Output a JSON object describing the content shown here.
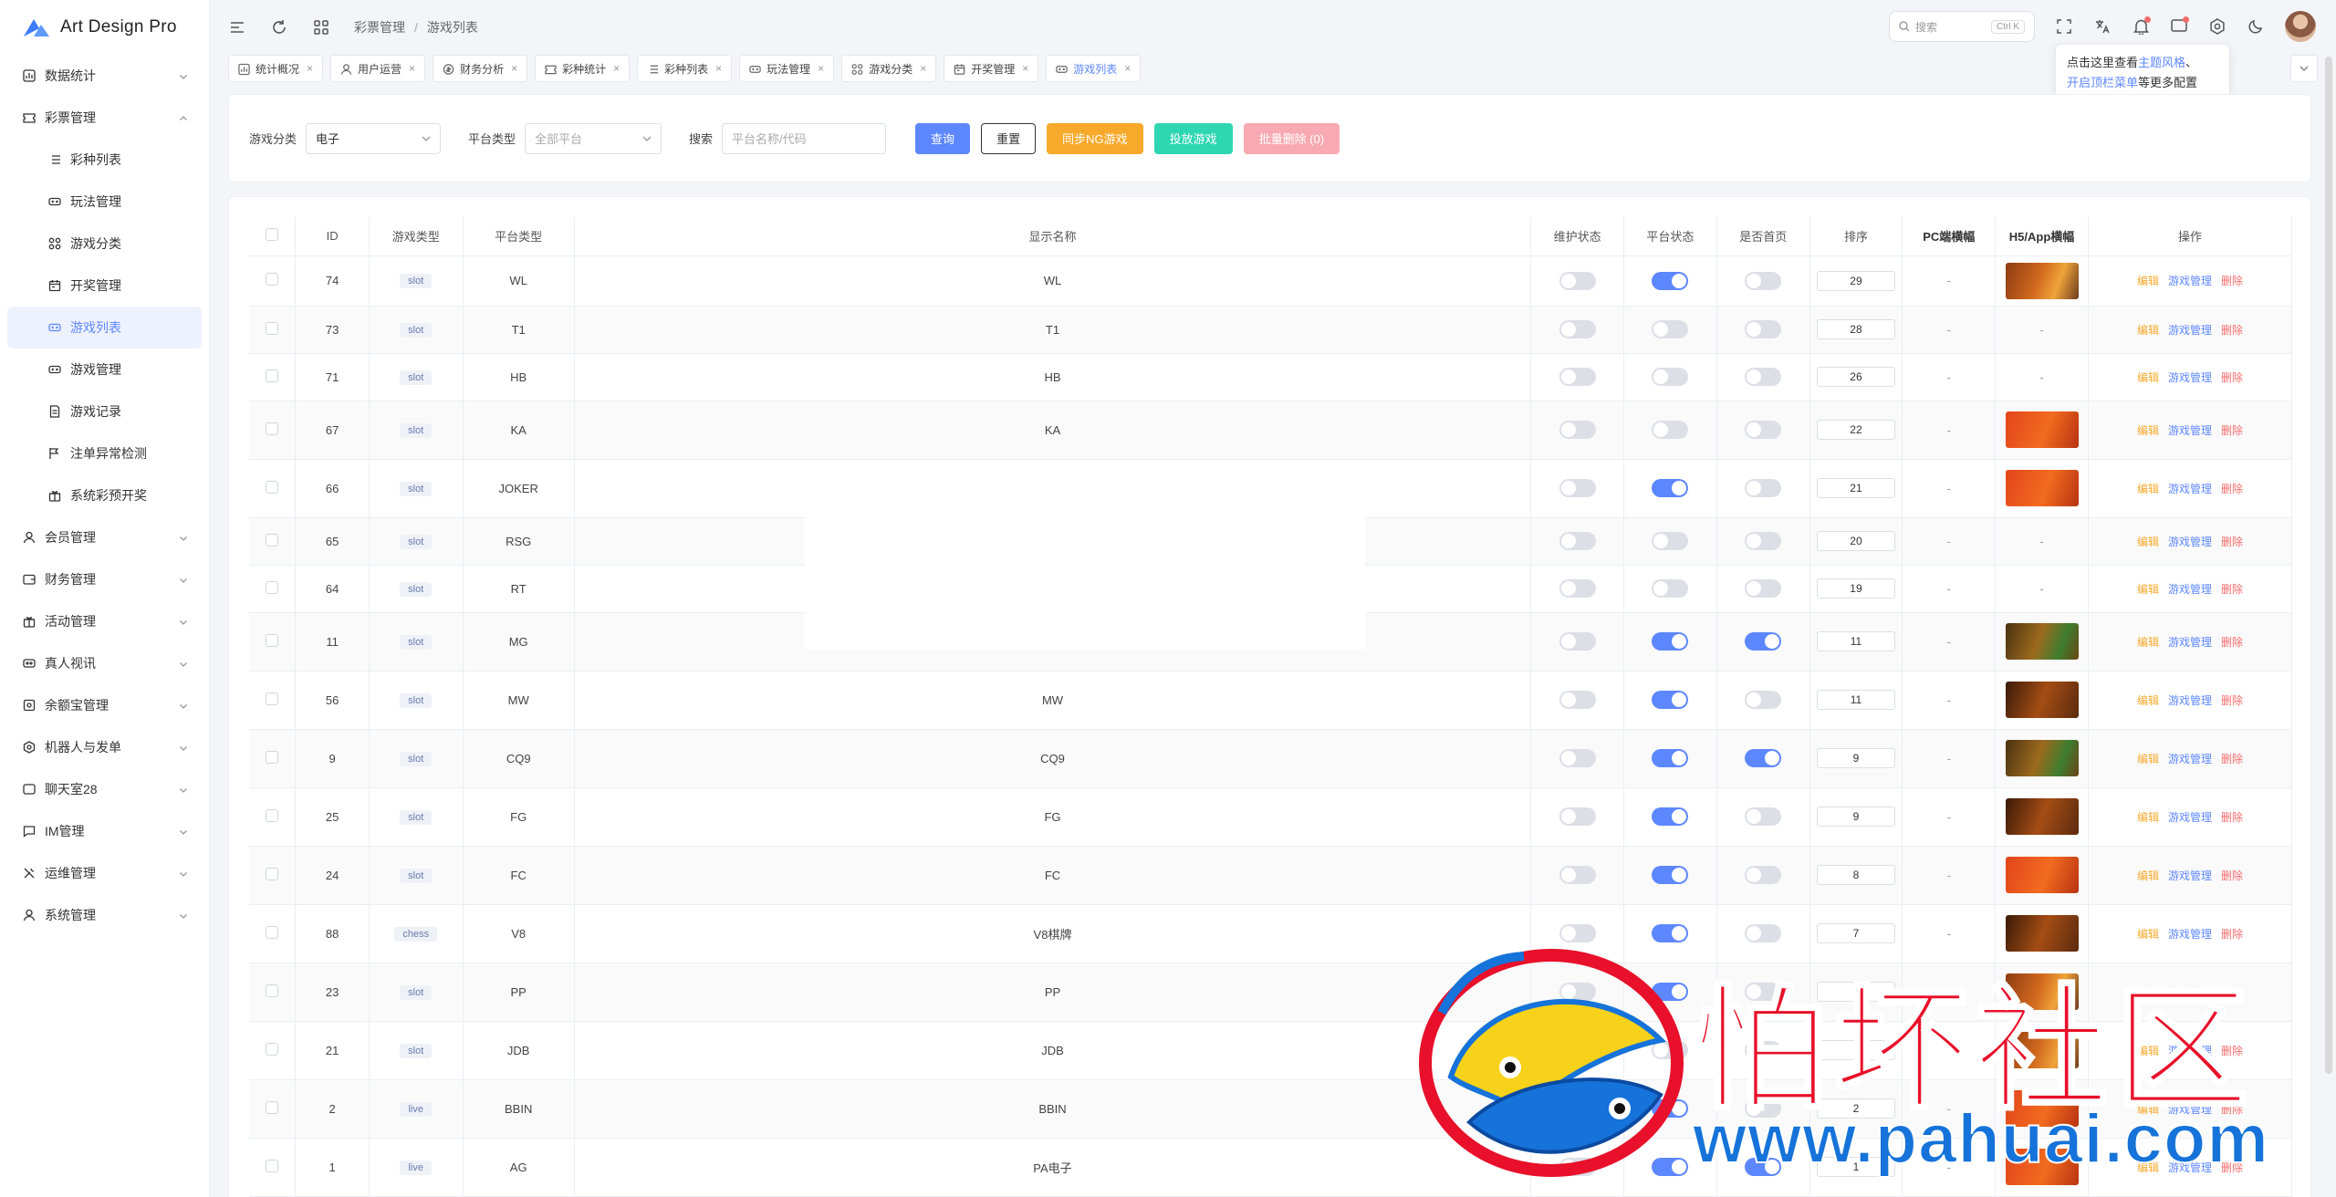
{
  "app": {
    "name": "Art Design Pro"
  },
  "sidebar": {
    "groups": [
      {
        "label": "数据统计",
        "icon": "chart-grid-icon",
        "expanded": false
      },
      {
        "label": "彩票管理",
        "icon": "ticket-icon",
        "expanded": true
      },
      {
        "label": "会员管理",
        "icon": "user-icon",
        "expanded": false
      },
      {
        "label": "财务管理",
        "icon": "wallet-icon",
        "expanded": false
      },
      {
        "label": "活动管理",
        "icon": "gift-icon",
        "expanded": false
      },
      {
        "label": "真人视讯",
        "icon": "video-icon",
        "expanded": false
      },
      {
        "label": "余额宝管理",
        "icon": "safe-icon",
        "expanded": false
      },
      {
        "label": "机器人与发单",
        "icon": "robot-icon",
        "expanded": false
      },
      {
        "label": "聊天室28",
        "icon": "chat-room-icon",
        "expanded": false
      },
      {
        "label": "IM管理",
        "icon": "message-icon",
        "expanded": false
      },
      {
        "label": "运维管理",
        "icon": "tools-icon",
        "expanded": false
      },
      {
        "label": "系统管理",
        "icon": "user-gear-icon",
        "expanded": false
      }
    ],
    "sub_items": [
      {
        "label": "彩种列表",
        "icon": "list-icon",
        "active": false
      },
      {
        "label": "玩法管理",
        "icon": "gamepad-icon",
        "active": false
      },
      {
        "label": "游戏分类",
        "icon": "category-icon",
        "active": false
      },
      {
        "label": "开奖管理",
        "icon": "calendar-icon",
        "active": false
      },
      {
        "label": "游戏列表",
        "icon": "gamepad-icon",
        "active": true
      },
      {
        "label": "游戏管理",
        "icon": "gamepad-icon",
        "active": false
      },
      {
        "label": "游戏记录",
        "icon": "record-icon",
        "active": false
      },
      {
        "label": "注单异常检测",
        "icon": "inspect-icon",
        "active": false
      },
      {
        "label": "系统彩预开奖",
        "icon": "gift-icon",
        "active": false
      }
    ]
  },
  "topbar": {
    "breadcrumb": [
      "彩票管理",
      "游戏列表"
    ],
    "search_placeholder": "搜索",
    "search_shortcut": "Ctrl K"
  },
  "tooltip": {
    "line1_pre": "点击这里查看",
    "line1_hl": "主题风格",
    "line1_post": "、",
    "line2_pre": "开启",
    "line2_hl": "顶栏菜单",
    "line2_post": "等更多配置"
  },
  "tabs": [
    {
      "label": "统计概况",
      "icon": "chart-grid-icon",
      "active": false
    },
    {
      "label": "用户运营",
      "icon": "user-icon",
      "active": false
    },
    {
      "label": "财务分析",
      "icon": "coin-icon",
      "active": false
    },
    {
      "label": "彩种统计",
      "icon": "ticket-icon",
      "active": false
    },
    {
      "label": "彩种列表",
      "icon": "list-icon",
      "active": false
    },
    {
      "label": "玩法管理",
      "icon": "gamepad-icon",
      "active": false
    },
    {
      "label": "游戏分类",
      "icon": "category-icon",
      "active": false
    },
    {
      "label": "开奖管理",
      "icon": "calendar-icon",
      "active": false
    },
    {
      "label": "游戏列表",
      "icon": "gamepad-icon",
      "active": true
    }
  ],
  "filter": {
    "category_label": "游戏分类",
    "category_value": "电子",
    "platform_label": "平台类型",
    "platform_placeholder": "全部平台",
    "search_label": "搜索",
    "search_placeholder": "平台名称/代码",
    "btn_query": "查询",
    "btn_reset": "重置",
    "btn_sync": "同步NG游戏",
    "btn_add": "投放游戏",
    "btn_batch_delete": "批量删除 (0)"
  },
  "table": {
    "headers": [
      "ID",
      "游戏类型",
      "平台类型",
      "显示名称",
      "维护状态",
      "平台状态",
      "是否首页",
      "排序",
      "PC端横幅",
      "H5/App横幅",
      "操作"
    ],
    "actions": {
      "edit": "编辑",
      "manage": "游戏管理",
      "delete": "删除"
    },
    "dash": "-",
    "rows": [
      {
        "id": "74",
        "type": "slot",
        "platform": "WL",
        "name": "WL",
        "maint": false,
        "plat_on": true,
        "home": false,
        "sort": "29",
        "h5_banner": "orange"
      },
      {
        "id": "73",
        "type": "slot",
        "platform": "T1",
        "name": "T1",
        "maint": false,
        "plat_on": false,
        "home": false,
        "sort": "28",
        "h5_banner": ""
      },
      {
        "id": "71",
        "type": "slot",
        "platform": "HB",
        "name": "HB",
        "maint": false,
        "plat_on": false,
        "home": false,
        "sort": "26",
        "h5_banner": ""
      },
      {
        "id": "67",
        "type": "slot",
        "platform": "KA",
        "name": "KA",
        "maint": false,
        "plat_on": false,
        "home": false,
        "sort": "22",
        "h5_banner": "red"
      },
      {
        "id": "66",
        "type": "slot",
        "platform": "JOKER",
        "name": "",
        "maint": false,
        "plat_on": true,
        "home": false,
        "sort": "21",
        "h5_banner": "red"
      },
      {
        "id": "65",
        "type": "slot",
        "platform": "RSG",
        "name": "",
        "maint": false,
        "plat_on": false,
        "home": false,
        "sort": "20",
        "h5_banner": ""
      },
      {
        "id": "64",
        "type": "slot",
        "platform": "RT",
        "name": "",
        "maint": false,
        "plat_on": false,
        "home": false,
        "sort": "19",
        "h5_banner": ""
      },
      {
        "id": "11",
        "type": "slot",
        "platform": "MG",
        "name": "MG",
        "maint": false,
        "plat_on": true,
        "home": true,
        "sort": "11",
        "h5_banner": "green"
      },
      {
        "id": "56",
        "type": "slot",
        "platform": "MW",
        "name": "MW",
        "maint": false,
        "plat_on": true,
        "home": false,
        "sort": "11",
        "h5_banner": "dark"
      },
      {
        "id": "9",
        "type": "slot",
        "platform": "CQ9",
        "name": "CQ9",
        "maint": false,
        "plat_on": true,
        "home": true,
        "sort": "9",
        "h5_banner": "green"
      },
      {
        "id": "25",
        "type": "slot",
        "platform": "FG",
        "name": "FG",
        "maint": false,
        "plat_on": true,
        "home": false,
        "sort": "9",
        "h5_banner": "dark"
      },
      {
        "id": "24",
        "type": "slot",
        "platform": "FC",
        "name": "FC",
        "maint": false,
        "plat_on": true,
        "home": false,
        "sort": "8",
        "h5_banner": "red"
      },
      {
        "id": "88",
        "type": "chess",
        "platform": "V8",
        "name": "V8棋牌",
        "maint": false,
        "plat_on": true,
        "home": false,
        "sort": "7",
        "h5_banner": "dark"
      },
      {
        "id": "23",
        "type": "slot",
        "platform": "PP",
        "name": "PP",
        "maint": false,
        "plat_on": true,
        "home": false,
        "sort": "5",
        "h5_banner": "orange"
      },
      {
        "id": "21",
        "type": "slot",
        "platform": "JDB",
        "name": "JDB",
        "maint": false,
        "plat_on": false,
        "home": false,
        "sort": "3",
        "h5_banner": "orange"
      },
      {
        "id": "2",
        "type": "live",
        "platform": "BBIN",
        "name": "BBIN",
        "maint": false,
        "plat_on": true,
        "home": false,
        "sort": "2",
        "h5_banner": "red"
      },
      {
        "id": "1",
        "type": "live",
        "platform": "AG",
        "name": "PA电子",
        "maint": false,
        "plat_on": true,
        "home": true,
        "sort": "1",
        "h5_banner": "red"
      }
    ]
  },
  "watermark": {
    "text": "怕坏社区",
    "url": "www.pahuai.com"
  },
  "colors": {
    "primary": "#5d87ff",
    "warning": "#f7a92b",
    "success": "#2ed6b2",
    "danger": "#f56c6c"
  }
}
